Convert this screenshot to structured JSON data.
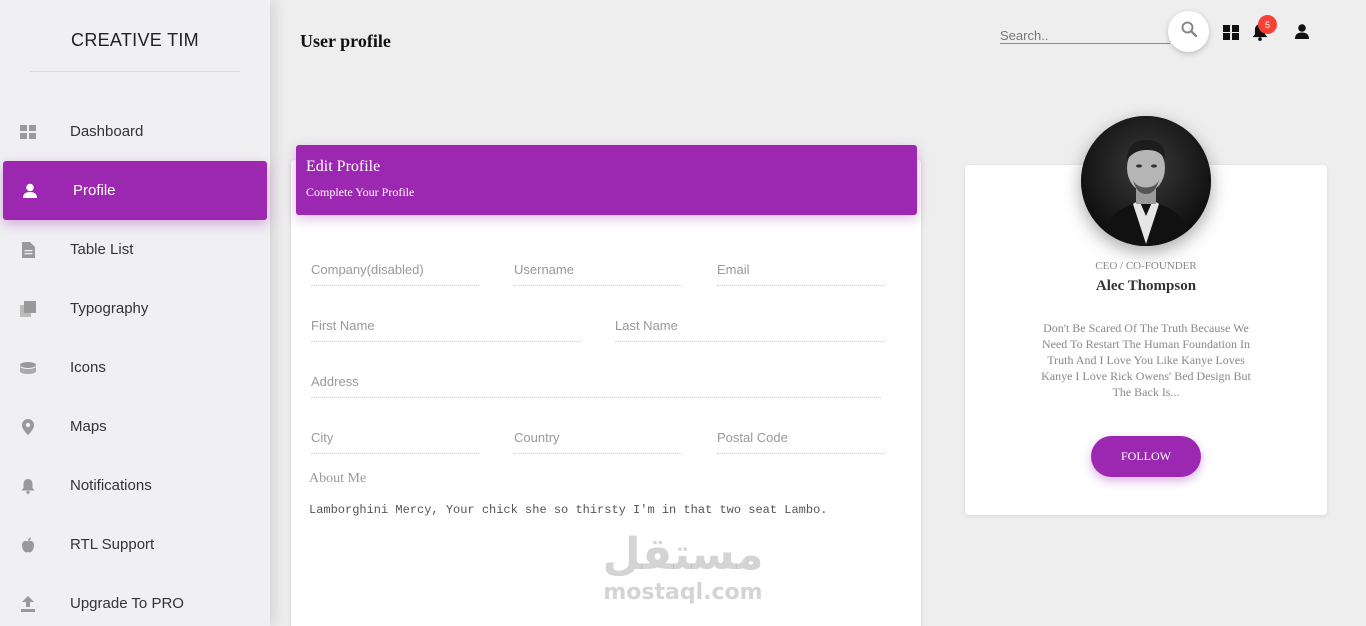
{
  "sidebar": {
    "brand": "CREATIVE TIM",
    "items": [
      {
        "label": "Dashboard",
        "icon": "dashboard-icon"
      },
      {
        "label": "Profile",
        "icon": "person-icon",
        "active": true
      },
      {
        "label": "Table List",
        "icon": "document-icon"
      },
      {
        "label": "Typography",
        "icon": "library-books-icon"
      },
      {
        "label": "Icons",
        "icon": "layers-icon"
      },
      {
        "label": "Maps",
        "icon": "location-pin-icon"
      },
      {
        "label": "Notifications",
        "icon": "bell-icon"
      },
      {
        "label": "RTL Support",
        "icon": "apple-icon"
      },
      {
        "label": "Upgrade To PRO",
        "icon": "upload-icon"
      }
    ]
  },
  "header": {
    "title": "User profile",
    "search_placeholder": "Search..",
    "notification_count": "5"
  },
  "edit_profile": {
    "title": "Edit Profile",
    "subtitle": "Complete Your Profile",
    "fields": {
      "company": "Company(disabled)",
      "username": "Username",
      "email": "Email",
      "first_name": "First Name",
      "last_name": "Last Name",
      "address": "Address",
      "city": "City",
      "country": "Country",
      "postal_code": "Postal Code"
    },
    "about_label": "About Me",
    "about_text": "Lamborghini Mercy, Your chick she so thirsty I'm in that two seat Lambo."
  },
  "profile_card": {
    "role": "CEO / CO-FOUNDER",
    "name": "Alec Thompson",
    "bio": "Don't Be Scared Of The Truth Because We Need To Restart The Human Foundation In Truth And I Love You Like Kanye Loves Kanye I Love Rick Owens' Bed Design But The Back Is...",
    "follow_label": "FOLLOW"
  },
  "watermark": {
    "arabic": "مستقل",
    "latin": "mostaql.com"
  },
  "colors": {
    "accent": "#9c27b0",
    "badge": "#f44336",
    "sidebar_bg": "#f0f0f2",
    "page_bg": "#eeeeee"
  }
}
